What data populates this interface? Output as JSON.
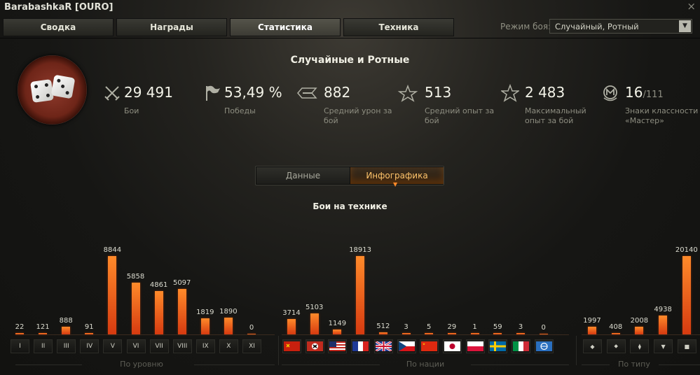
{
  "window": {
    "title": "BarabashkaR [OURO]",
    "close_glyph": "×"
  },
  "tabs": [
    {
      "label": "Сводка",
      "active": false
    },
    {
      "label": "Награды",
      "active": false
    },
    {
      "label": "Статистика",
      "active": true
    },
    {
      "label": "Техника",
      "active": false
    }
  ],
  "battle_mode": {
    "label": "Режим боя:",
    "value": "Случайный, Ротный"
  },
  "section_title": "Случайные и Ротные",
  "stats": [
    {
      "icon": "crossed-swords-icon",
      "value": "29 491",
      "extra": "",
      "label": "Бои"
    },
    {
      "icon": "flag-icon",
      "value": "53,49 %",
      "extra": "",
      "label": "Победы"
    },
    {
      "icon": "damage-icon",
      "value": "882",
      "extra": "",
      "label": "Средний урон за бой"
    },
    {
      "icon": "star-xp-icon",
      "value": "513",
      "extra": "",
      "label": "Средний опыт за бой"
    },
    {
      "icon": "star-max-icon",
      "value": "2 483",
      "extra": "",
      "label": "Максимальный опыт за бой"
    },
    {
      "icon": "mastery-badge-icon",
      "value": "16",
      "extra": "/111",
      "label": "Знаки классности «Мастер»"
    }
  ],
  "view_toggle": {
    "left": "Данные",
    "right": "Инфографика",
    "active": "right"
  },
  "chart_title": "Бои на технике",
  "chart_data": [
    {
      "type": "bar",
      "xlabel": "По уровню",
      "categories": [
        "I",
        "II",
        "III",
        "IV",
        "V",
        "VI",
        "VII",
        "VIII",
        "IX",
        "X",
        "XI"
      ],
      "values": [
        22,
        121,
        888,
        91,
        8844,
        5858,
        4861,
        5097,
        1819,
        1890,
        0
      ]
    },
    {
      "type": "bar",
      "xlabel": "По нации",
      "categories": [
        "ussr",
        "germany",
        "usa",
        "france",
        "uk",
        "czech",
        "china",
        "japan",
        "poland",
        "sweden",
        "italy",
        "intunion"
      ],
      "values": [
        3714,
        5103,
        1149,
        18913,
        512,
        3,
        5,
        29,
        1,
        59,
        3,
        0
      ]
    },
    {
      "type": "bar",
      "xlabel": "По типу",
      "categories": [
        "light-tank",
        "medium-tank",
        "heavy-tank",
        "at-spg",
        "spg"
      ],
      "values": [
        1997,
        408,
        2008,
        4938,
        20140
      ]
    }
  ],
  "colors": {
    "bar_top": "#ff8a2a",
    "bar_bottom": "#d63a10",
    "accent_text": "#ffc46a"
  }
}
